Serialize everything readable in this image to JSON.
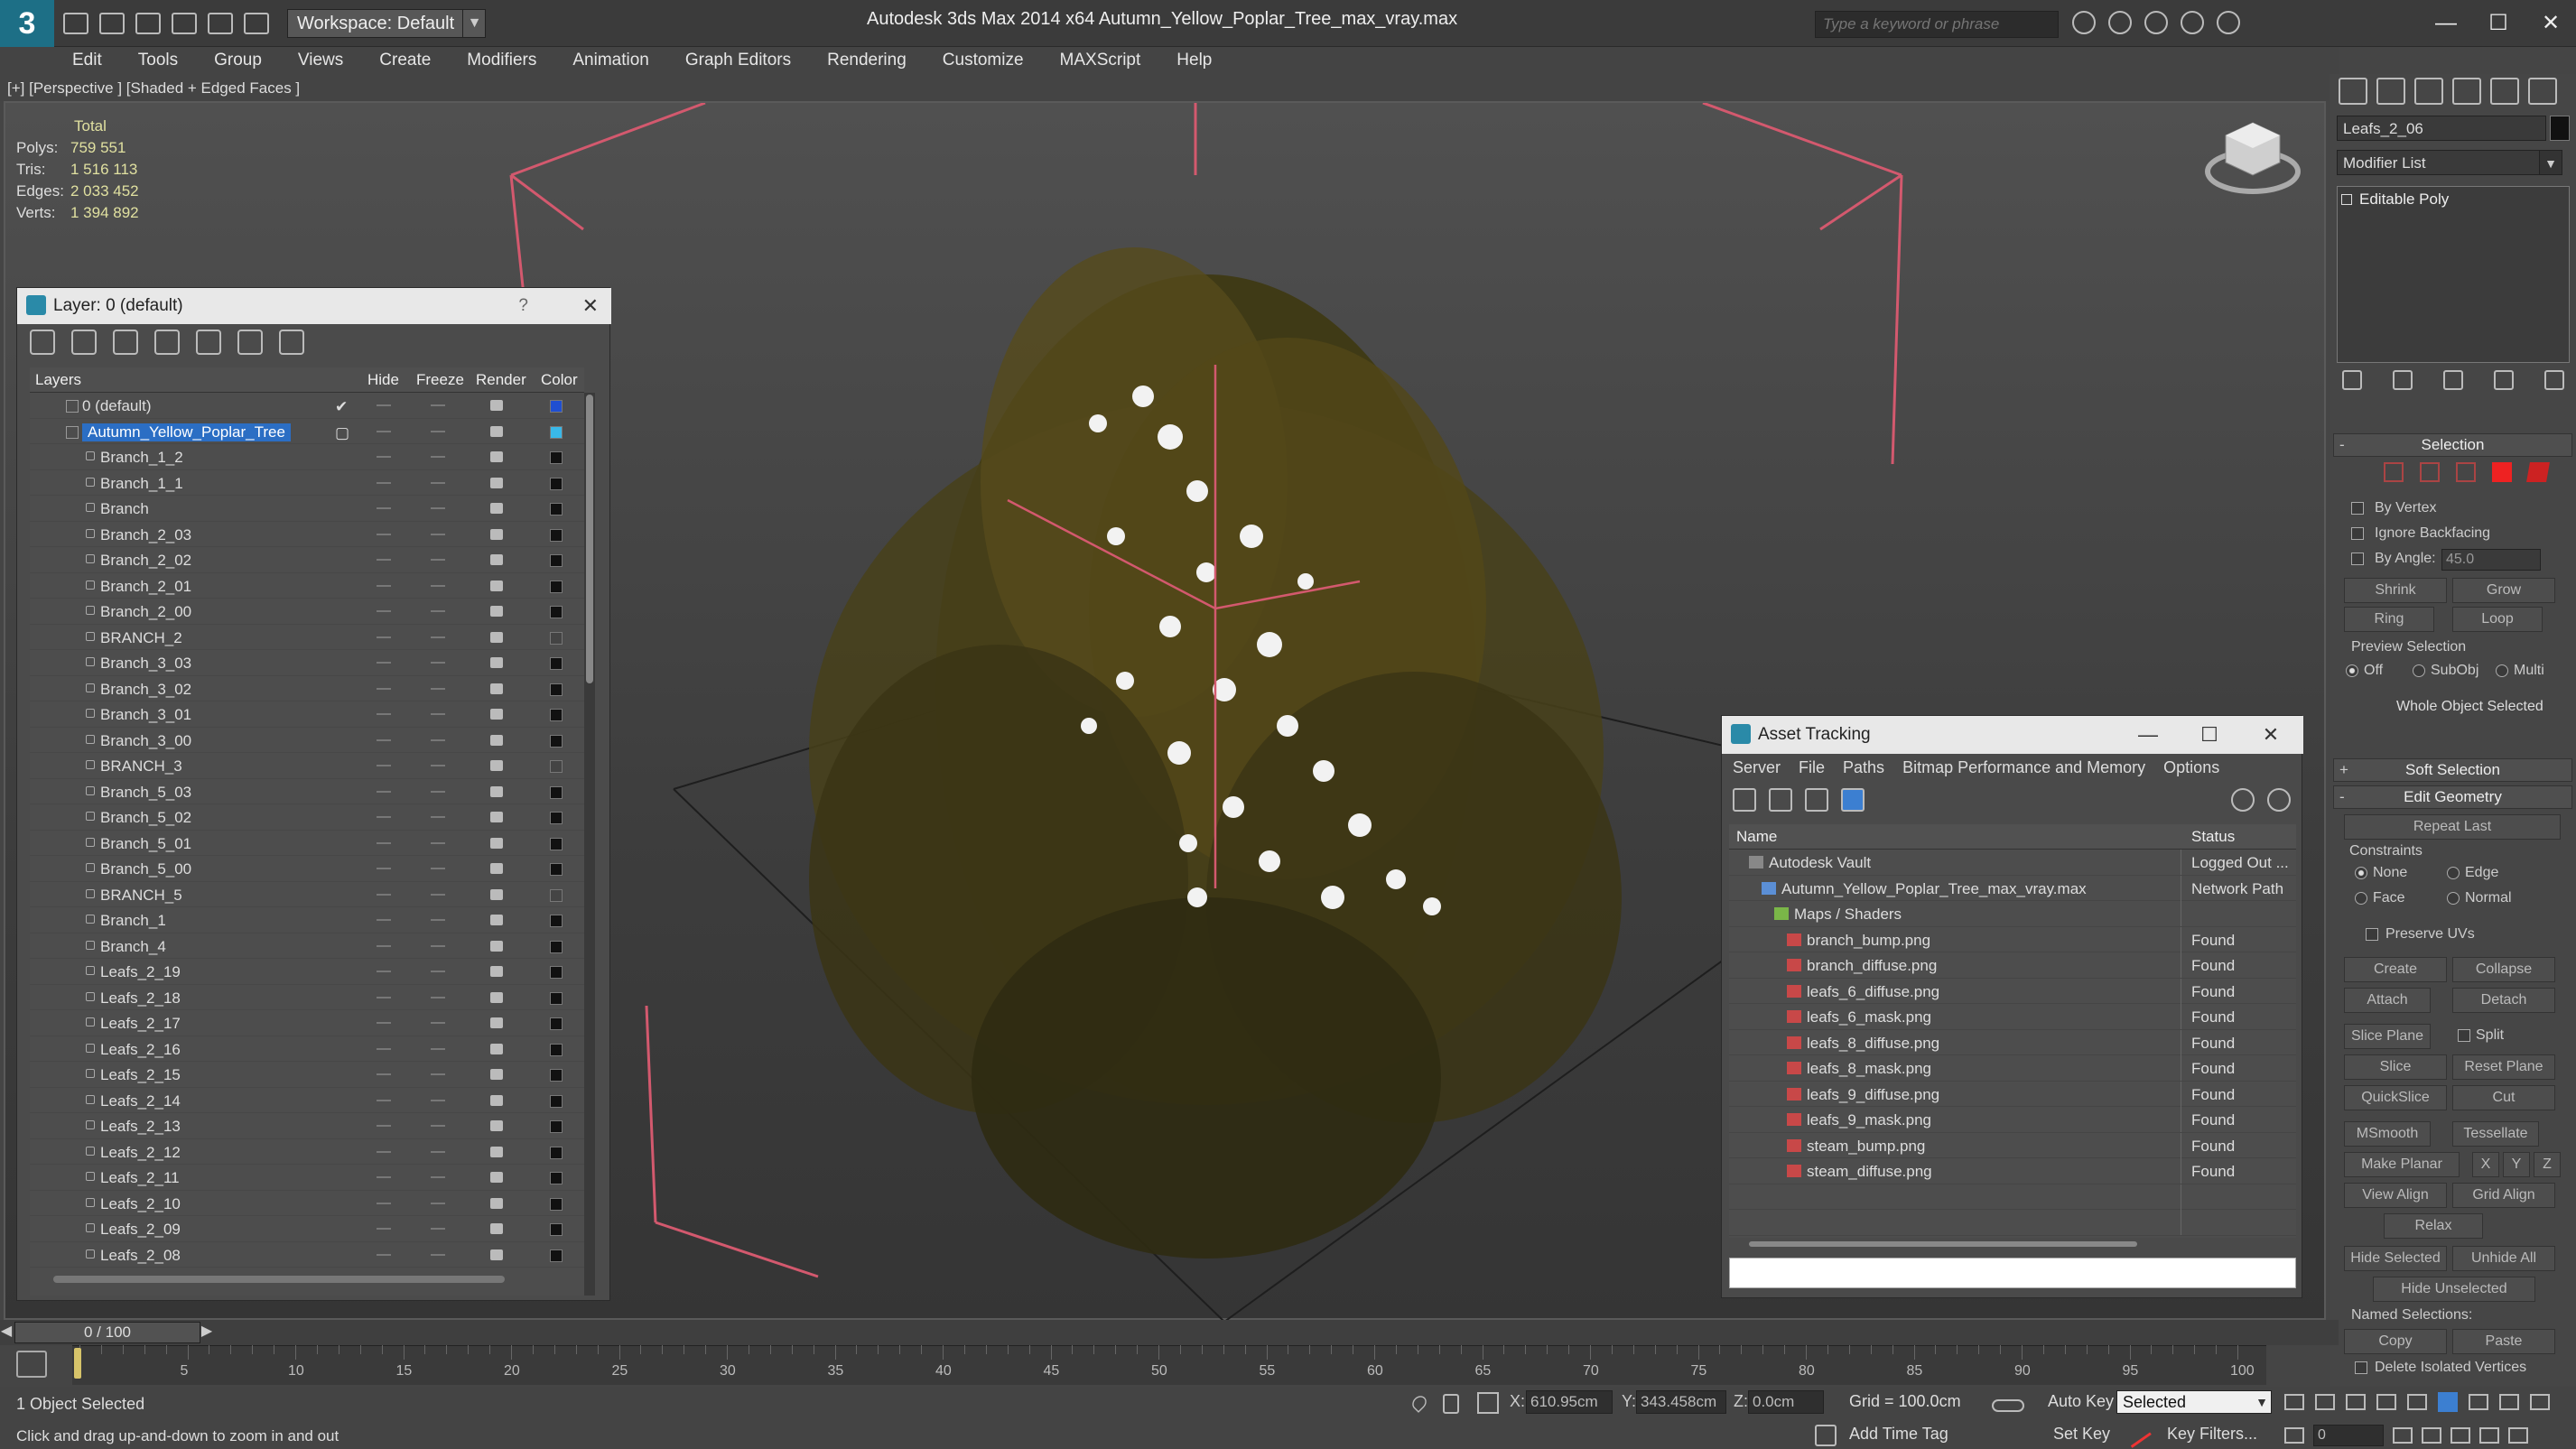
{
  "app": {
    "workspace": "Workspace: Default",
    "title": "Autodesk 3ds Max  2014 x64     Autumn_Yellow_Poplar_Tree_max_vray.max",
    "search_placeholder": "Type a keyword or phrase",
    "minimize": "—",
    "maximize": "☐",
    "close": "✕"
  },
  "menu": [
    "Edit",
    "Tools",
    "Group",
    "Views",
    "Create",
    "Modifiers",
    "Animation",
    "Graph Editors",
    "Rendering",
    "Customize",
    "MAXScript",
    "Help"
  ],
  "viewport": {
    "label": "[+] [Perspective ] [Shaded + Edged Faces ]",
    "stats_header": "Total",
    "stats": [
      {
        "label": "Polys:",
        "value": "759 551"
      },
      {
        "label": "Tris:",
        "value": "1 516 113"
      },
      {
        "label": "Edges:",
        "value": "2 033 452"
      },
      {
        "label": "Verts:",
        "value": "1 394 892"
      }
    ]
  },
  "layer_window": {
    "title": "Layer: 0 (default)",
    "help": "?",
    "close": "✕",
    "columns": {
      "layers": "Layers",
      "hide": "Hide",
      "freeze": "Freeze",
      "render": "Render",
      "color": "Color"
    },
    "rows": [
      {
        "name": "0 (default)",
        "level": 0,
        "active": true,
        "color": "#1f4fd1"
      },
      {
        "name": "Autumn_Yellow_Poplar_Tree",
        "level": 0,
        "selected": true,
        "color": "#39b8e8"
      },
      {
        "name": "Branch_1_2",
        "level": 1,
        "color": "#111111"
      },
      {
        "name": "Branch_1_1",
        "level": 1,
        "color": "#111111"
      },
      {
        "name": "Branch",
        "level": 1,
        "color": "#111111"
      },
      {
        "name": "Branch_2_03",
        "level": 1,
        "color": "#111111"
      },
      {
        "name": "Branch_2_02",
        "level": 1,
        "color": "#111111"
      },
      {
        "name": "Branch_2_01",
        "level": 1,
        "color": "#111111"
      },
      {
        "name": "Branch_2_00",
        "level": 1,
        "color": "#111111"
      },
      {
        "name": "BRANCH_2",
        "level": 1,
        "color": "#444444"
      },
      {
        "name": "Branch_3_03",
        "level": 1,
        "color": "#111111"
      },
      {
        "name": "Branch_3_02",
        "level": 1,
        "color": "#111111"
      },
      {
        "name": "Branch_3_01",
        "level": 1,
        "color": "#111111"
      },
      {
        "name": "Branch_3_00",
        "level": 1,
        "color": "#111111"
      },
      {
        "name": "BRANCH_3",
        "level": 1,
        "color": "#444444"
      },
      {
        "name": "Branch_5_03",
        "level": 1,
        "color": "#111111"
      },
      {
        "name": "Branch_5_02",
        "level": 1,
        "color": "#111111"
      },
      {
        "name": "Branch_5_01",
        "level": 1,
        "color": "#111111"
      },
      {
        "name": "Branch_5_00",
        "level": 1,
        "color": "#111111"
      },
      {
        "name": "BRANCH_5",
        "level": 1,
        "color": "#444444"
      },
      {
        "name": "Branch_1",
        "level": 1,
        "color": "#111111"
      },
      {
        "name": "Branch_4",
        "level": 1,
        "color": "#111111"
      },
      {
        "name": "Leafs_2_19",
        "level": 1,
        "color": "#111111"
      },
      {
        "name": "Leafs_2_18",
        "level": 1,
        "color": "#111111"
      },
      {
        "name": "Leafs_2_17",
        "level": 1,
        "color": "#111111"
      },
      {
        "name": "Leafs_2_16",
        "level": 1,
        "color": "#111111"
      },
      {
        "name": "Leafs_2_15",
        "level": 1,
        "color": "#111111"
      },
      {
        "name": "Leafs_2_14",
        "level": 1,
        "color": "#111111"
      },
      {
        "name": "Leafs_2_13",
        "level": 1,
        "color": "#111111"
      },
      {
        "name": "Leafs_2_12",
        "level": 1,
        "color": "#111111"
      },
      {
        "name": "Leafs_2_11",
        "level": 1,
        "color": "#111111"
      },
      {
        "name": "Leafs_2_10",
        "level": 1,
        "color": "#111111"
      },
      {
        "name": "Leafs_2_09",
        "level": 1,
        "color": "#111111"
      },
      {
        "name": "Leafs_2_08",
        "level": 1,
        "color": "#111111"
      }
    ]
  },
  "asset_window": {
    "title": "Asset Tracking",
    "menu": [
      "Server",
      "File",
      "Paths",
      "Bitmap Performance and Memory",
      "Options"
    ],
    "columns": {
      "name": "Name",
      "status": "Status"
    },
    "rows": [
      {
        "name": "Autodesk Vault",
        "status": "Logged Out ...",
        "level": 0,
        "kind": "vault"
      },
      {
        "name": "Autumn_Yellow_Poplar_Tree_max_vray.max",
        "status": "Network Path",
        "level": 1,
        "kind": "file"
      },
      {
        "name": "Maps / Shaders",
        "status": "",
        "level": 2,
        "kind": "folder"
      },
      {
        "name": "branch_bump.png",
        "status": "Found",
        "level": 3,
        "kind": "image"
      },
      {
        "name": "branch_diffuse.png",
        "status": "Found",
        "level": 3,
        "kind": "image"
      },
      {
        "name": "leafs_6_diffuse.png",
        "status": "Found",
        "level": 3,
        "kind": "image"
      },
      {
        "name": "leafs_6_mask.png",
        "status": "Found",
        "level": 3,
        "kind": "image"
      },
      {
        "name": "leafs_8_diffuse.png",
        "status": "Found",
        "level": 3,
        "kind": "image"
      },
      {
        "name": "leafs_8_mask.png",
        "status": "Found",
        "level": 3,
        "kind": "image"
      },
      {
        "name": "leafs_9_diffuse.png",
        "status": "Found",
        "level": 3,
        "kind": "image"
      },
      {
        "name": "leafs_9_mask.png",
        "status": "Found",
        "level": 3,
        "kind": "image"
      },
      {
        "name": "steam_bump.png",
        "status": "Found",
        "level": 3,
        "kind": "image"
      },
      {
        "name": "steam_diffuse.png",
        "status": "Found",
        "level": 3,
        "kind": "image"
      }
    ]
  },
  "command_panel": {
    "object_name": "Leafs_2_06",
    "modifier_list": "Modifier List",
    "stack_item": "Editable Poly",
    "selection": {
      "title": "Selection",
      "by_vertex": "By Vertex",
      "ignore_backfacing": "Ignore Backfacing",
      "by_angle": "By Angle:",
      "angle_value": "45.0",
      "shrink": "Shrink",
      "grow": "Grow",
      "ring": "Ring",
      "loop": "Loop",
      "preview_selection": "Preview Selection",
      "off": "Off",
      "subobj": "SubObj",
      "multi": "Multi",
      "whole_object": "Whole Object Selected"
    },
    "soft_selection": "Soft Selection",
    "edit_geometry": {
      "title": "Edit Geometry",
      "repeat_last": "Repeat Last",
      "constraints": "Constraints",
      "none": "None",
      "edge": "Edge",
      "face": "Face",
      "normal": "Normal",
      "preserve_uvs": "Preserve UVs",
      "create": "Create",
      "collapse": "Collapse",
      "attach": "Attach",
      "detach": "Detach",
      "slice_plane": "Slice Plane",
      "split": "Split",
      "slice": "Slice",
      "reset_plane": "Reset Plane",
      "quickslice": "QuickSlice",
      "cut": "Cut",
      "msmooth": "MSmooth",
      "tessellate": "Tessellate",
      "make_planar": "Make Planar",
      "x": "X",
      "y": "Y",
      "z": "Z",
      "view_align": "View Align",
      "grid_align": "Grid Align",
      "relax": "Relax",
      "hide_selected": "Hide Selected",
      "unhide_all": "Unhide All",
      "hide_unselected": "Hide Unselected",
      "named_selections": "Named Selections:",
      "copy": "Copy",
      "paste": "Paste",
      "delete_isolated": "Delete Isolated Vertices"
    }
  },
  "timeline": {
    "slider": "0 / 100",
    "ticks": [
      "5",
      "10",
      "15",
      "20",
      "25",
      "30",
      "35",
      "40",
      "45",
      "50",
      "55",
      "60",
      "65",
      "70",
      "75",
      "80",
      "85",
      "90",
      "95",
      "100"
    ]
  },
  "status": {
    "selected": "1 Object Selected",
    "hint": "Click and drag up-and-down to zoom in and out",
    "x_label": "X:",
    "x_value": "610.95cm",
    "y_label": "Y:",
    "y_value": "343.458cm",
    "z_label": "Z:",
    "z_value": "0.0cm",
    "grid": "Grid = 100.0cm",
    "auto_key": "Auto Key",
    "selected_filter": "Selected",
    "set_key": "Set Key",
    "key_filters": "Key Filters...",
    "add_time_tag": "Add Time Tag",
    "frame": "0"
  }
}
